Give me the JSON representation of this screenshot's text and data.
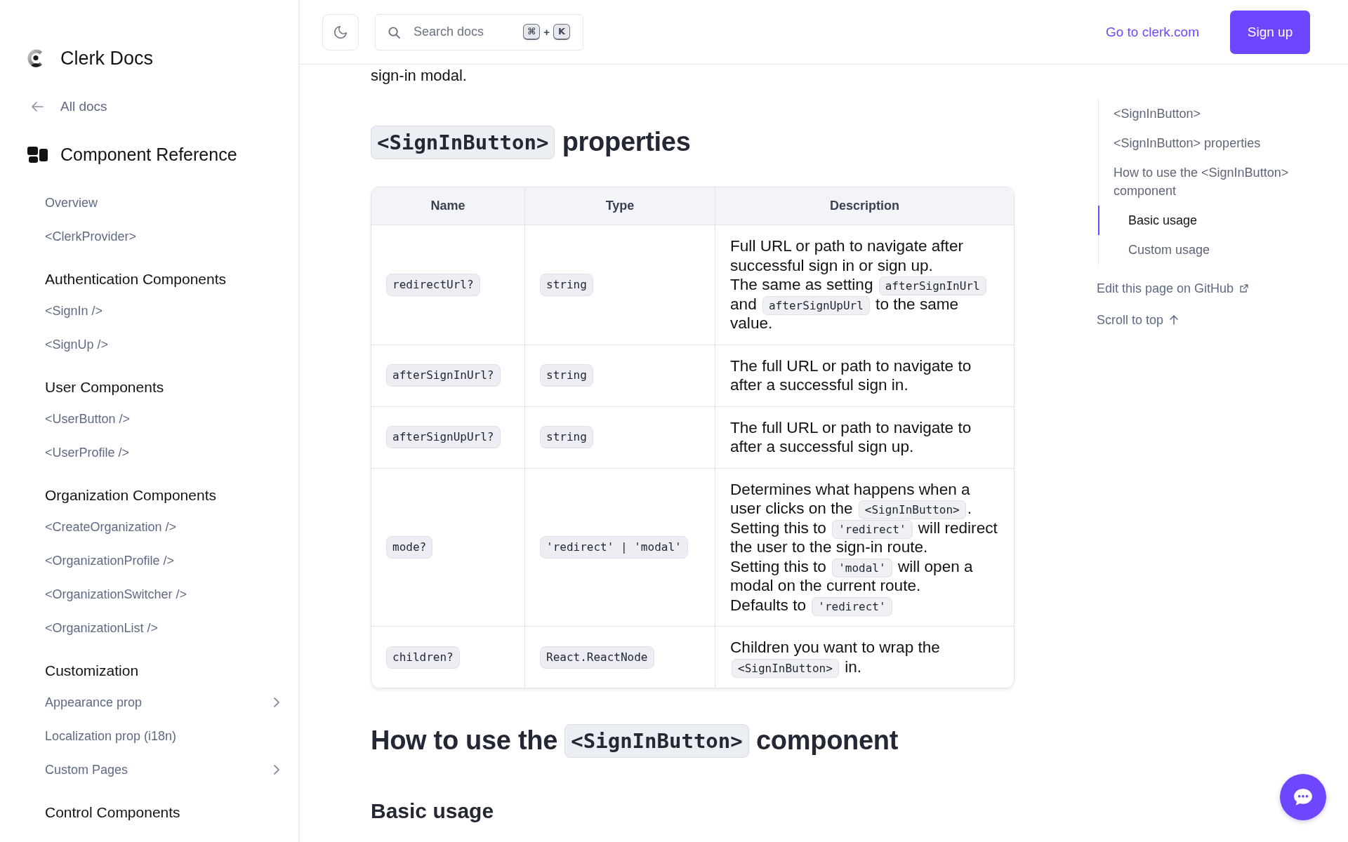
{
  "sidebar": {
    "logo": {
      "title": "Clerk Docs"
    },
    "back_link": {
      "label": "All docs"
    },
    "section": {
      "title": "Component Reference"
    },
    "items": [
      {
        "label": "Overview",
        "expandable": false
      },
      {
        "label": "<ClerkProvider>",
        "expandable": false
      }
    ],
    "groups": [
      {
        "title": "Authentication Components",
        "items": [
          {
            "label": "<SignIn />",
            "expandable": false
          },
          {
            "label": "<SignUp />",
            "expandable": false
          }
        ]
      },
      {
        "title": "User Components",
        "items": [
          {
            "label": "<UserButton />",
            "expandable": false
          },
          {
            "label": "<UserProfile />",
            "expandable": false
          }
        ]
      },
      {
        "title": "Organization Components",
        "items": [
          {
            "label": "<CreateOrganization />",
            "expandable": false
          },
          {
            "label": "<OrganizationProfile />",
            "expandable": false
          },
          {
            "label": "<OrganizationSwitcher />",
            "expandable": false
          },
          {
            "label": "<OrganizationList />",
            "expandable": false
          }
        ]
      },
      {
        "title": "Customization",
        "items": [
          {
            "label": "Appearance prop",
            "expandable": true
          },
          {
            "label": "Localization prop (i18n)",
            "expandable": false
          },
          {
            "label": "Custom Pages",
            "expandable": true
          }
        ]
      },
      {
        "title": "Control Components"
      }
    ]
  },
  "header": {
    "search": {
      "placeholder": "Search docs",
      "shortcut": {
        "keys": [
          "⌘",
          "K"
        ],
        "separator": "+"
      }
    },
    "link": "Go to clerk.com",
    "button": "Sign up"
  },
  "article": {
    "blocks": [
      {
        "kind": "paragraph",
        "text": "sign-in modal."
      },
      {
        "kind": "heading",
        "parts": [
          {
            "kind": "code",
            "text": "<SignInButton>"
          },
          {
            "kind": "text",
            "text": " properties"
          }
        ]
      },
      {
        "kind": "table",
        "columns": [
          "Name",
          "Type",
          "Description"
        ],
        "rows": [
          {
            "name": "redirectUrl?",
            "type": "string",
            "description": [
              [
                {
                  "kind": "text",
                  "text": "Full URL or path to navigate after successful sign in or sign up."
                }
              ],
              [
                {
                  "kind": "text",
                  "text": "The same as setting "
                },
                {
                  "kind": "code",
                  "text": "afterSignInUrl"
                },
                {
                  "kind": "text",
                  "text": " and "
                },
                {
                  "kind": "code",
                  "text": "afterSignUpUrl"
                },
                {
                  "kind": "text",
                  "text": " to the same value."
                }
              ]
            ]
          },
          {
            "name": "afterSignInUrl?",
            "type": "string",
            "description": [
              [
                {
                  "kind": "text",
                  "text": "The full URL or path to navigate to after a successful sign in."
                }
              ]
            ]
          },
          {
            "name": "afterSignUpUrl?",
            "type": "string",
            "description": [
              [
                {
                  "kind": "text",
                  "text": "The full URL or path to navigate to after a successful sign up."
                }
              ]
            ]
          },
          {
            "name": "mode?",
            "type": "'redirect' | 'modal'",
            "description": [
              [
                {
                  "kind": "text",
                  "text": "Determines what happens when a user clicks on the "
                },
                {
                  "kind": "code",
                  "text": "<SignInButton>"
                },
                {
                  "kind": "text",
                  "text": "."
                }
              ],
              [
                {
                  "kind": "text",
                  "text": "Setting this to "
                },
                {
                  "kind": "code",
                  "text": "'redirect'"
                },
                {
                  "kind": "text",
                  "text": " will redirect the user to the sign-in route."
                }
              ],
              [
                {
                  "kind": "text",
                  "text": "Setting this to "
                },
                {
                  "kind": "code",
                  "text": "'modal'"
                },
                {
                  "kind": "text",
                  "text": " will open a modal on the current route."
                }
              ],
              [
                {
                  "kind": "text",
                  "text": "Defaults to "
                },
                {
                  "kind": "code",
                  "text": "'redirect'"
                }
              ]
            ]
          },
          {
            "name": "children?",
            "type": "React.ReactNode",
            "description": [
              [
                {
                  "kind": "text",
                  "text": "Children you want to wrap the "
                },
                {
                  "kind": "code",
                  "text": "<SignInButton>"
                },
                {
                  "kind": "text",
                  "text": " in."
                }
              ]
            ]
          }
        ]
      },
      {
        "kind": "heading",
        "parts": [
          {
            "kind": "text",
            "text": "How to use the "
          },
          {
            "kind": "code",
            "text": "<SignInButton>"
          },
          {
            "kind": "text",
            "text": " component"
          }
        ]
      },
      {
        "kind": "subheading",
        "text": "Basic usage"
      }
    ]
  },
  "toc": {
    "items": [
      {
        "label": "<SignInButton>",
        "selected": false
      },
      {
        "label": "<SignInButton> properties",
        "selected": false
      },
      {
        "label": "How to use the <SignInButton> component",
        "selected": false,
        "children": [
          {
            "label": "Basic usage",
            "selected": true
          },
          {
            "label": "Custom usage",
            "selected": false
          }
        ]
      }
    ],
    "edit_link": "Edit this page on GitHub",
    "scroll_top": "Scroll to top"
  }
}
